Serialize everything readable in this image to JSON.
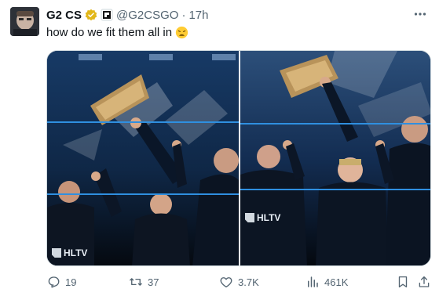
{
  "post": {
    "author": {
      "display_name": "G2 CS",
      "handle": "@G2CSGO",
      "time_separator": "·",
      "time": "17h"
    },
    "text": "how do we fit them all in",
    "emoji": "weary-face-emoji",
    "media": {
      "images": [
        {
          "watermark": "HLTV"
        },
        {
          "watermark": "HLTV"
        }
      ]
    },
    "actions": {
      "replies": "19",
      "reposts": "37",
      "likes": "3.7K",
      "views": "461K"
    }
  },
  "colors": {
    "text_primary": "#0f1419",
    "text_secondary": "#536471",
    "verified_gold": "#e2b719",
    "divider_line": "#2f8fe0",
    "border": "#cfd9de"
  },
  "icons": [
    "avatar-image",
    "verified-gold-icon",
    "affiliate-badge-icon",
    "more-options-icon",
    "reply-icon",
    "repost-icon",
    "like-icon",
    "views-icon",
    "bookmark-icon",
    "share-icon"
  ]
}
